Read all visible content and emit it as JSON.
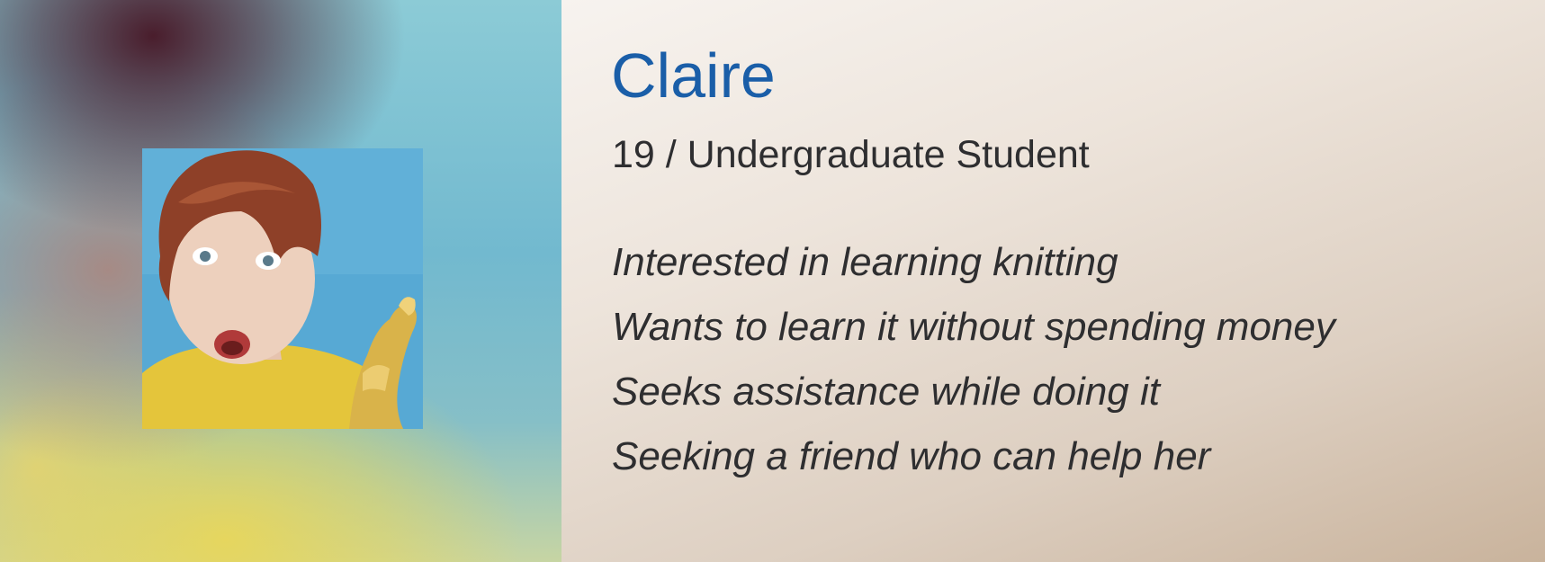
{
  "persona": {
    "name": "Claire",
    "subtitle": "19 / Undergraduate Student",
    "traits": [
      "Interested in learning knitting",
      "Wants to learn it without spending money",
      "Seeks assistance while doing it",
      "Seeking a friend who can help her"
    ]
  },
  "colors": {
    "name_color": "#1a5ea8",
    "text_color": "#2e2e30"
  }
}
